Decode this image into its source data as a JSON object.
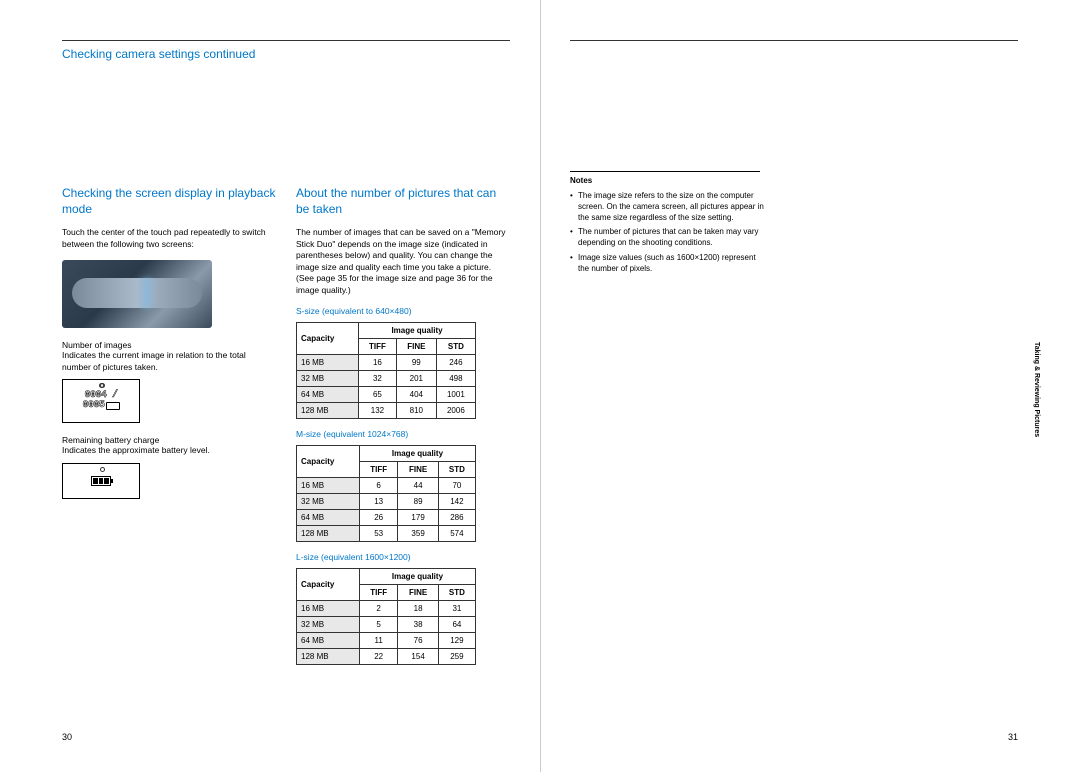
{
  "running_head": "Checking camera settings continued",
  "left": {
    "title": "Checking the screen display in playback mode",
    "intro": "Touch the center of the touch pad repeatedly to switch between the following two screens:",
    "num_head": "Number of images",
    "num_text": "Indicates the current image in relation to the total number of pictures taken.",
    "lcd_line1": "0004 /",
    "lcd_line2": "0005",
    "batt_head": "Remaining battery charge",
    "batt_text": "Indicates the approximate battery level."
  },
  "mid": {
    "title": "About the number of pictures that can be taken",
    "intro": "The number of images that can be saved on a \"Memory Stick Duo\" depends on the image size (indicated in parentheses below) and quality. You can change the image size and quality each time you take a picture. (See page 35 for the image size and page 36 for the image quality.)",
    "tables": [
      {
        "title": "S-size (equivalent to 640×480)",
        "rows": [
          {
            "cap": "16 MB",
            "tiff": "16",
            "fine": "99",
            "std": "246"
          },
          {
            "cap": "32 MB",
            "tiff": "32",
            "fine": "201",
            "std": "498"
          },
          {
            "cap": "64 MB",
            "tiff": "65",
            "fine": "404",
            "std": "1001"
          },
          {
            "cap": "128 MB",
            "tiff": "132",
            "fine": "810",
            "std": "2006"
          }
        ]
      },
      {
        "title": "M-size (equivalent 1024×768)",
        "rows": [
          {
            "cap": "16 MB",
            "tiff": "6",
            "fine": "44",
            "std": "70"
          },
          {
            "cap": "32 MB",
            "tiff": "13",
            "fine": "89",
            "std": "142"
          },
          {
            "cap": "64 MB",
            "tiff": "26",
            "fine": "179",
            "std": "286"
          },
          {
            "cap": "128 MB",
            "tiff": "53",
            "fine": "359",
            "std": "574"
          }
        ]
      },
      {
        "title": "L-size (equivalent 1600×1200)",
        "rows": [
          {
            "cap": "16 MB",
            "tiff": "2",
            "fine": "18",
            "std": "31"
          },
          {
            "cap": "32 MB",
            "tiff": "5",
            "fine": "38",
            "std": "64"
          },
          {
            "cap": "64 MB",
            "tiff": "11",
            "fine": "76",
            "std": "129"
          },
          {
            "cap": "128 MB",
            "tiff": "22",
            "fine": "154",
            "std": "259"
          }
        ]
      }
    ],
    "th": {
      "iq": "Image quality",
      "cap": "Capacity",
      "tiff": "TIFF",
      "fine": "FINE",
      "std": "STD"
    }
  },
  "notes": {
    "head": "Notes",
    "items": [
      "The image size refers to the size on the computer screen. On the camera screen, all pictures appear in the same size regardless of the size setting.",
      "The number of pictures that can be taken may vary depending on the shooting conditions.",
      "Image size values (such as 1600×1200) represent the number of pixels."
    ]
  },
  "side_tab": "Taking & Reviewing\nPictures",
  "page_left": "30",
  "page_right": "31"
}
